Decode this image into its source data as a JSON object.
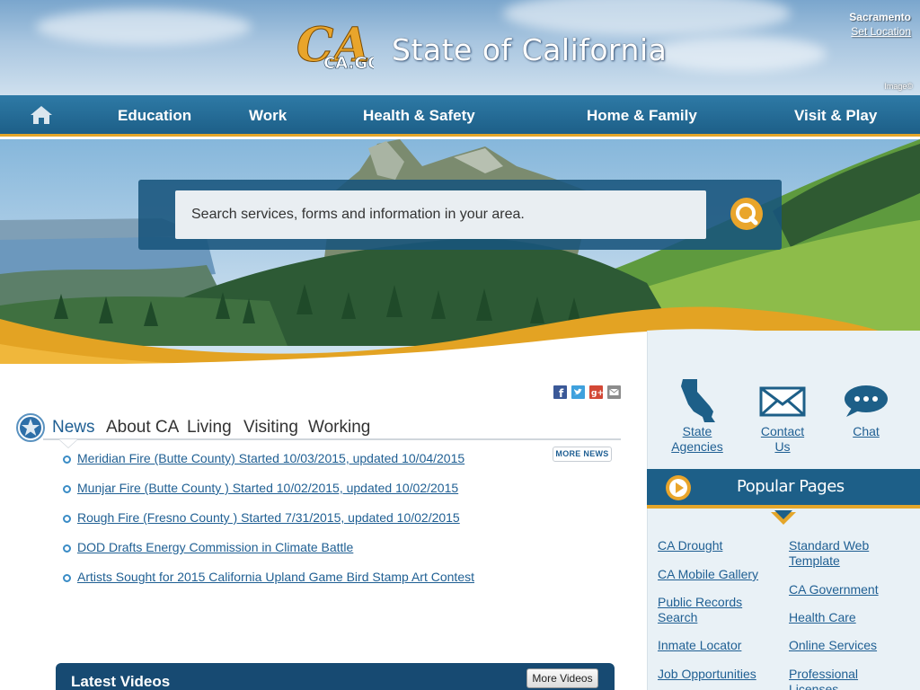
{
  "header": {
    "logo_text": "CA.GOV",
    "title": "State of California",
    "location_city": "Sacramento",
    "location_link": "Set Location",
    "image_credit": "Image©"
  },
  "nav": {
    "home_icon": "home-icon",
    "items": [
      {
        "label": "Education"
      },
      {
        "label": "Work"
      },
      {
        "label": "Health & Safety"
      },
      {
        "label": "Home & Family"
      },
      {
        "label": "Visit & Play"
      }
    ]
  },
  "search": {
    "placeholder": "Search services, forms and information in your area.",
    "button_icon": "search-icon"
  },
  "share_icons": [
    "facebook-icon",
    "twitter-icon",
    "google-plus-icon",
    "email-icon"
  ],
  "tabs": [
    {
      "label": "News"
    },
    {
      "label": "About CA"
    },
    {
      "label": "Living"
    },
    {
      "label": "Visiting"
    },
    {
      "label": "Working"
    }
  ],
  "more_news": "MORE NEWS",
  "news": [
    {
      "text": "Meridian Fire (Butte County) Started 10/03/2015, updated 10/04/2015"
    },
    {
      "text": "Munjar Fire (Butte County ) Started 10/02/2015, updated 10/02/2015"
    },
    {
      "text": "Rough Fire (Fresno County ) Started 7/31/2015, updated 10/02/2015"
    },
    {
      "text": "DOD Drafts Energy Commission in Climate Battle"
    },
    {
      "text": "Artists Sought for 2015 California Upland Game Bird Stamp Art Contest"
    }
  ],
  "videos": {
    "title": "Latest Videos",
    "more_button": "More Videos"
  },
  "quick_links": [
    {
      "line1": "State",
      "line2": "Agencies",
      "icon": "california-map-icon"
    },
    {
      "line1": "Contact",
      "line2": "Us",
      "icon": "envelope-icon"
    },
    {
      "line1": "Chat",
      "line2": "",
      "icon": "chat-bubble-icon"
    }
  ],
  "popular": {
    "title": "Popular Pages",
    "left": [
      {
        "line1": "CA Drought",
        "line2": ""
      },
      {
        "line1": "CA Mobile Gallery",
        "line2": ""
      },
      {
        "line1": "Public Records",
        "line2": "Search"
      },
      {
        "line1": "Inmate Locator",
        "line2": ""
      },
      {
        "line1": "Job Opportunities",
        "line2": ""
      }
    ],
    "right": [
      {
        "line1": "Standard Web",
        "line2": "Template"
      },
      {
        "line1": "CA Government",
        "line2": ""
      },
      {
        "line1": "Health Care",
        "line2": ""
      },
      {
        "line1": "Online Services",
        "line2": ""
      },
      {
        "line1": "Professional",
        "line2": "Licenses"
      }
    ]
  },
  "colors": {
    "nav_blue": "#1d5f88",
    "accent_gold": "#e4a62a",
    "link_blue": "#1f5f93",
    "aside_bg": "#e9f1f6"
  }
}
